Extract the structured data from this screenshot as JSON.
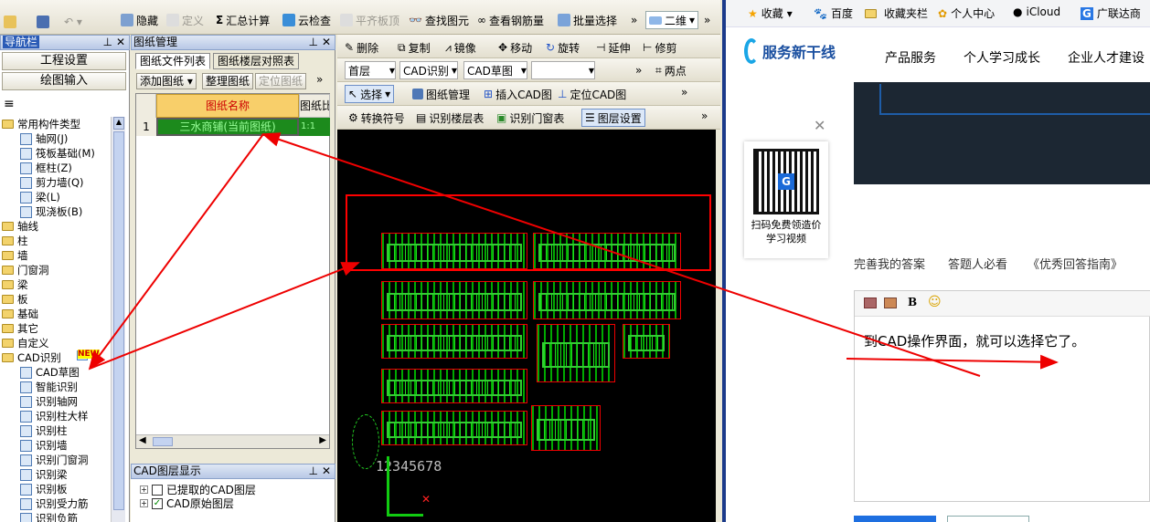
{
  "toolbar": {
    "hide": "隐藏",
    "define": "定义",
    "sum": "汇总计算",
    "cloud_check": "云检查",
    "flat_top": "平齐板顶",
    "find": "查找图元",
    "view_rebar": "查看钢筋量",
    "batch_select": "批量选择",
    "view_mode": "二维"
  },
  "nav": {
    "title": "导航栏",
    "btn1": "工程设置",
    "btn2": "绘图输入",
    "items": [
      {
        "label": "常用构件类型",
        "type": "folder"
      },
      {
        "label": "轴网(J)",
        "type": "leaf"
      },
      {
        "label": "筏板基础(M)",
        "type": "leaf"
      },
      {
        "label": "框柱(Z)",
        "type": "leaf"
      },
      {
        "label": "剪力墙(Q)",
        "type": "leaf"
      },
      {
        "label": "梁(L)",
        "type": "leaf"
      },
      {
        "label": "现浇板(B)",
        "type": "leaf"
      },
      {
        "label": "轴线",
        "type": "folder"
      },
      {
        "label": "柱",
        "type": "folder"
      },
      {
        "label": "墙",
        "type": "folder"
      },
      {
        "label": "门窗洞",
        "type": "folder"
      },
      {
        "label": "梁",
        "type": "folder"
      },
      {
        "label": "板",
        "type": "folder"
      },
      {
        "label": "基础",
        "type": "folder"
      },
      {
        "label": "其它",
        "type": "folder"
      },
      {
        "label": "自定义",
        "type": "folder"
      },
      {
        "label": "CAD识别",
        "type": "folder"
      },
      {
        "label": "CAD草图",
        "type": "leaf"
      },
      {
        "label": "智能识别",
        "type": "leaf"
      },
      {
        "label": "识别轴网",
        "type": "leaf"
      },
      {
        "label": "识别柱大样",
        "type": "leaf"
      },
      {
        "label": "识别柱",
        "type": "leaf"
      },
      {
        "label": "识别墙",
        "type": "leaf"
      },
      {
        "label": "识别门窗洞",
        "type": "leaf"
      },
      {
        "label": "识别梁",
        "type": "leaf"
      },
      {
        "label": "识别板",
        "type": "leaf"
      },
      {
        "label": "识别受力筋",
        "type": "leaf"
      },
      {
        "label": "识别负筋",
        "type": "leaf"
      }
    ],
    "new_badge": "NEW"
  },
  "drawing_mgr": {
    "title": "图纸管理",
    "tab1": "图纸文件列表",
    "tab2": "图纸楼层对照表",
    "btn_add": "添加图纸",
    "btn_arrange": "整理图纸",
    "btn_locate": "定位图纸",
    "col_name": "图纸名称",
    "col_scale": "图纸比",
    "row_index": "1",
    "row_name": "三水商铺(当前图纸)",
    "row_scale": "1:1"
  },
  "layer_panel": {
    "title": "CAD图层显示",
    "item1": "已提取的CAD图层",
    "item2": "CAD原始图层"
  },
  "cad_toolbar": {
    "delete": "删除",
    "copy": "复制",
    "mirror": "镜像",
    "move": "移动",
    "rotate": "旋转",
    "extend": "延伸",
    "trim": "修剪",
    "floor": "首层",
    "cad_recog": "CAD识别",
    "cad_sketch": "CAD草图",
    "two_point": "两点",
    "select": "选择",
    "drawing_mgr": "图纸管理",
    "insert_cad": "插入CAD图",
    "locate_cad": "定位CAD图",
    "convert_symbol": "转换符号",
    "recog_floor_table": "识别楼层表",
    "recog_door_window": "识别门窗表",
    "layer_settings": "图层设置",
    "canvas_text": "12345678"
  },
  "browser": {
    "bookmarks": [
      "收藏",
      "百度",
      "收藏夹栏",
      "个人中心",
      "iCloud",
      "广联达商"
    ],
    "logo": "服务新干线",
    "nav": [
      "产品服务",
      "个人学习成长",
      "企业人才建设"
    ],
    "qr_caption": "扫码免费领造价学习视频",
    "links": [
      "完善我的答案",
      "答题人必看",
      "《优秀回答指南》"
    ],
    "answer_text": "到CAD操作界面，就可以选择它了。"
  }
}
